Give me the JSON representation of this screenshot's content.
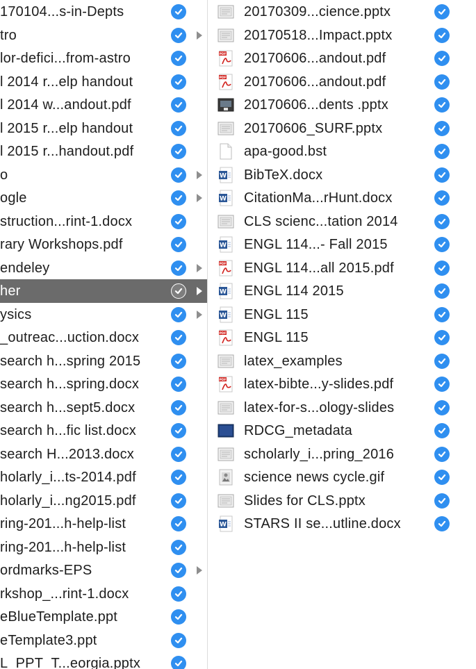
{
  "left_column": {
    "items": [
      {
        "name": "170104...s-in-Depts",
        "synced": true,
        "folder": false
      },
      {
        "name": "tro",
        "synced": true,
        "folder": true
      },
      {
        "name": "lor-defici...from-astro",
        "synced": true,
        "folder": false
      },
      {
        "name": "l 2014 r...elp handout",
        "synced": true,
        "folder": false
      },
      {
        "name": "l 2014 w...andout.pdf",
        "synced": true,
        "folder": false
      },
      {
        "name": "l 2015 r...elp handout",
        "synced": true,
        "folder": false
      },
      {
        "name": "l 2015 r...handout.pdf",
        "synced": true,
        "folder": false
      },
      {
        "name": "o",
        "synced": true,
        "folder": true
      },
      {
        "name": "ogle",
        "synced": true,
        "folder": true
      },
      {
        "name": "struction...rint-1.docx",
        "synced": true,
        "folder": false
      },
      {
        "name": "rary Workshops.pdf",
        "synced": true,
        "folder": false
      },
      {
        "name": "endeley",
        "synced": true,
        "folder": true
      },
      {
        "name": "her",
        "synced": true,
        "folder": true,
        "selected": true
      },
      {
        "name": "ysics",
        "synced": true,
        "folder": true
      },
      {
        "name": "_outreac...uction.docx",
        "synced": true,
        "folder": false
      },
      {
        "name": "search h...spring 2015",
        "synced": true,
        "folder": false
      },
      {
        "name": "search h...spring.docx",
        "synced": true,
        "folder": false
      },
      {
        "name": "search h...sept5.docx",
        "synced": true,
        "folder": false
      },
      {
        "name": "search h...fic list.docx",
        "synced": true,
        "folder": false
      },
      {
        "name": "search H...2013.docx",
        "synced": true,
        "folder": false
      },
      {
        "name": "holarly_i...ts-2014.pdf",
        "synced": true,
        "folder": false
      },
      {
        "name": "holarly_i...ng2015.pdf",
        "synced": true,
        "folder": false
      },
      {
        "name": "ring-201...h-help-list",
        "synced": true,
        "folder": false
      },
      {
        "name": "ring-201...h-help-list",
        "synced": true,
        "folder": false
      },
      {
        "name": "ordmarks-EPS",
        "synced": true,
        "folder": true
      },
      {
        "name": "rkshop_...rint-1.docx",
        "synced": true,
        "folder": false
      },
      {
        "name": "eBlueTemplate.ppt",
        "synced": true,
        "folder": false
      },
      {
        "name": "eTemplate3.ppt",
        "synced": true,
        "folder": false
      },
      {
        "name": "L_PPT_T...eorgia.pptx",
        "synced": true,
        "folder": false
      }
    ]
  },
  "right_column": {
    "items": [
      {
        "name": "20170309...cience.pptx",
        "icon": "presentation-icon",
        "synced": true
      },
      {
        "name": "20170518...Impact.pptx",
        "icon": "presentation-icon",
        "synced": true
      },
      {
        "name": "20170606...andout.pdf",
        "icon": "pdf-icon",
        "synced": true
      },
      {
        "name": "20170606...andout.pdf",
        "icon": "pdf-icon",
        "synced": true
      },
      {
        "name": "20170606...dents .pptx",
        "icon": "slide-dark-icon",
        "synced": true
      },
      {
        "name": "20170606_SURF.pptx",
        "icon": "presentation-icon",
        "synced": true
      },
      {
        "name": "apa-good.bst",
        "icon": "blank-document-icon",
        "synced": true
      },
      {
        "name": "BibTeX.docx",
        "icon": "word-icon",
        "synced": true
      },
      {
        "name": "CitationMa...rHunt.docx",
        "icon": "word-icon",
        "synced": true
      },
      {
        "name": "CLS scienc...tation 2014",
        "icon": "presentation-icon",
        "synced": true
      },
      {
        "name": "ENGL 114...- Fall 2015",
        "icon": "word-icon",
        "synced": true
      },
      {
        "name": "ENGL 114...all 2015.pdf",
        "icon": "pdf-icon",
        "synced": true
      },
      {
        "name": "ENGL 114 2015",
        "icon": "word-icon",
        "synced": true
      },
      {
        "name": "ENGL 115",
        "icon": "word-icon",
        "synced": true
      },
      {
        "name": "ENGL 115",
        "icon": "pdf-icon",
        "synced": true
      },
      {
        "name": "latex_examples",
        "icon": "presentation-icon",
        "synced": true
      },
      {
        "name": "latex-bibte...y-slides.pdf",
        "icon": "pdf-icon",
        "synced": true
      },
      {
        "name": "latex-for-s...ology-slides",
        "icon": "presentation-icon",
        "synced": true
      },
      {
        "name": "RDCG_metadata",
        "icon": "slide-blue-icon",
        "synced": true
      },
      {
        "name": "scholarly_i...pring_2016",
        "icon": "presentation-icon",
        "synced": true
      },
      {
        "name": "science news cycle.gif",
        "icon": "image-icon",
        "synced": true
      },
      {
        "name": "Slides for CLS.pptx",
        "icon": "presentation-icon",
        "synced": true
      },
      {
        "name": "STARS II se...utline.docx",
        "icon": "word-icon",
        "synced": true
      }
    ]
  },
  "colors": {
    "check_blue": "#2f8ff0",
    "selected_row": "#6b6b6b",
    "arrow_gray": "#8e8e8e",
    "pdf_red": "#d2231f",
    "word_blue": "#2b5797"
  }
}
